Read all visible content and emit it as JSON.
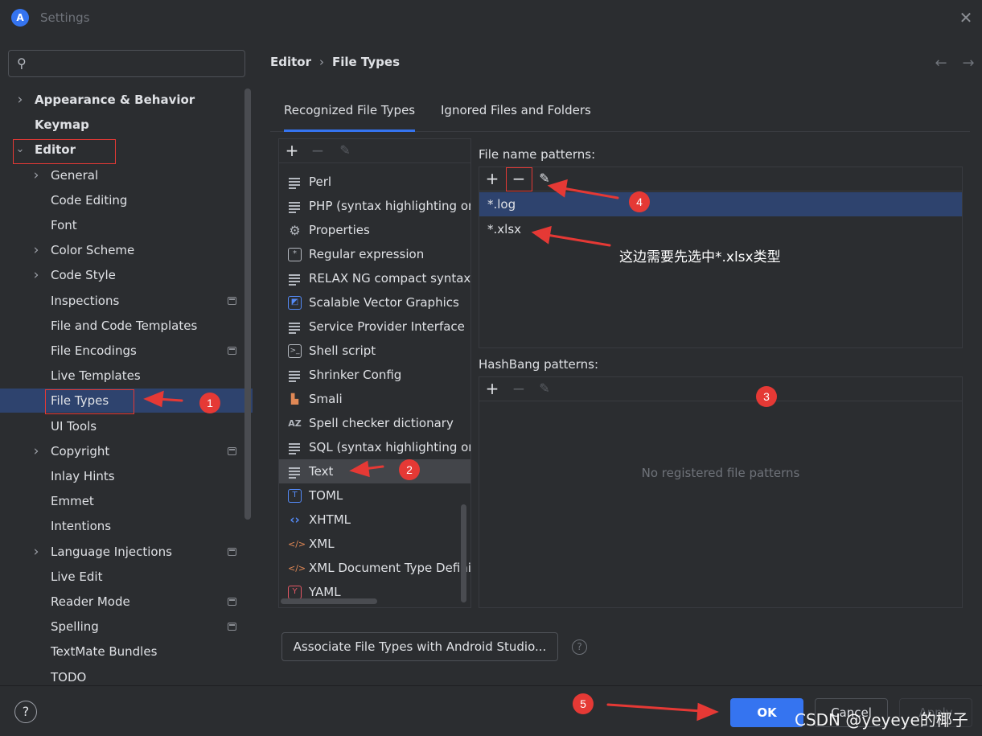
{
  "window": {
    "title": "Settings",
    "app_icon": "A"
  },
  "search": {
    "placeholder": ""
  },
  "sidebar": {
    "items": [
      {
        "label": "Appearance & Behavior",
        "level": 0,
        "expander": "collapsed",
        "bold": true
      },
      {
        "label": "Keymap",
        "level": 0,
        "expander": "none",
        "bold": true
      },
      {
        "label": "Editor",
        "level": 0,
        "expander": "expanded",
        "bold": true
      },
      {
        "label": "General",
        "level": 1,
        "expander": "collapsed"
      },
      {
        "label": "Code Editing",
        "level": 1,
        "expander": "none"
      },
      {
        "label": "Font",
        "level": 1,
        "expander": "none"
      },
      {
        "label": "Color Scheme",
        "level": 1,
        "expander": "collapsed"
      },
      {
        "label": "Code Style",
        "level": 1,
        "expander": "collapsed"
      },
      {
        "label": "Inspections",
        "level": 1,
        "expander": "none",
        "page_icon": true
      },
      {
        "label": "File and Code Templates",
        "level": 1,
        "expander": "none"
      },
      {
        "label": "File Encodings",
        "level": 1,
        "expander": "none",
        "page_icon": true
      },
      {
        "label": "Live Templates",
        "level": 1,
        "expander": "none"
      },
      {
        "label": "File Types",
        "level": 1,
        "expander": "none",
        "selected": true
      },
      {
        "label": "UI Tools",
        "level": 1,
        "expander": "none"
      },
      {
        "label": "Copyright",
        "level": 1,
        "expander": "collapsed",
        "page_icon": true
      },
      {
        "label": "Inlay Hints",
        "level": 1,
        "expander": "none"
      },
      {
        "label": "Emmet",
        "level": 1,
        "expander": "none"
      },
      {
        "label": "Intentions",
        "level": 1,
        "expander": "none"
      },
      {
        "label": "Language Injections",
        "level": 1,
        "expander": "collapsed",
        "page_icon": true
      },
      {
        "label": "Live Edit",
        "level": 1,
        "expander": "none"
      },
      {
        "label": "Reader Mode",
        "level": 1,
        "expander": "none",
        "page_icon": true
      },
      {
        "label": "Spelling",
        "level": 1,
        "expander": "none",
        "page_icon": true
      },
      {
        "label": "TextMate Bundles",
        "level": 1,
        "expander": "none"
      },
      {
        "label": "TODO",
        "level": 1,
        "expander": "none"
      }
    ]
  },
  "breadcrumb": {
    "parent": "Editor",
    "separator": "›",
    "current": "File Types"
  },
  "nav": {
    "back": "←",
    "forward": "→"
  },
  "tabs": [
    {
      "label": "Recognized File Types",
      "active": true
    },
    {
      "label": "Ignored Files and Folders",
      "active": false
    }
  ],
  "file_types": {
    "toolbar": {
      "add": "+",
      "remove": "−",
      "edit": "✎"
    },
    "items": [
      {
        "label": "Perl",
        "icon": "text-lines-icon"
      },
      {
        "label": "PHP (syntax highlighting only)",
        "icon": "text-lines-icon"
      },
      {
        "label": "Properties",
        "icon": "gear-icon"
      },
      {
        "label": "Regular expression",
        "icon": "regex-icon"
      },
      {
        "label": "RELAX NG compact syntax",
        "icon": "text-lines-icon"
      },
      {
        "label": "Scalable Vector Graphics",
        "icon": "image-icon"
      },
      {
        "label": "Service Provider Interface",
        "icon": "text-lines-icon"
      },
      {
        "label": "Shell script",
        "icon": "terminal-icon"
      },
      {
        "label": "Shrinker Config",
        "icon": "text-lines-icon"
      },
      {
        "label": "Smali",
        "icon": "smali-icon"
      },
      {
        "label": "Spell checker dictionary",
        "icon": "az-icon"
      },
      {
        "label": "SQL (syntax highlighting only)",
        "icon": "text-lines-icon"
      },
      {
        "label": "Text",
        "icon": "text-lines-icon",
        "selected": true
      },
      {
        "label": "TOML",
        "icon": "toml-icon"
      },
      {
        "label": "XHTML",
        "icon": "xhtml-icon"
      },
      {
        "label": "XML",
        "icon": "xml-icon"
      },
      {
        "label": "XML Document Type Definition",
        "icon": "xml-icon"
      },
      {
        "label": "YAML",
        "icon": "yaml-icon"
      }
    ]
  },
  "file_name_patterns": {
    "label": "File name patterns:",
    "toolbar": {
      "add": "+",
      "remove": "−",
      "edit": "✎"
    },
    "items": [
      {
        "value": "*.log",
        "selected": true
      },
      {
        "value": "*.xlsx",
        "selected": false
      }
    ]
  },
  "hashbang_patterns": {
    "label": "HashBang patterns:",
    "toolbar": {
      "add": "+",
      "remove": "−",
      "edit": "✎"
    },
    "empty_text": "No registered file patterns"
  },
  "associate_button": "Associate File Types with Android Studio...",
  "help_small": "?",
  "footer": {
    "help": "?",
    "ok": "OK",
    "cancel": "Cancel",
    "apply": "Apply",
    "watermark": "CSDN @yeyeye的椰子"
  },
  "annotations": {
    "badges": [
      "1",
      "2",
      "3",
      "4",
      "5"
    ],
    "note": "这边需要先选中*.xlsx类型",
    "color": "#e53935"
  },
  "colors": {
    "accent": "#3574f0",
    "selection": "#2e436e",
    "background": "#2b2d30"
  }
}
